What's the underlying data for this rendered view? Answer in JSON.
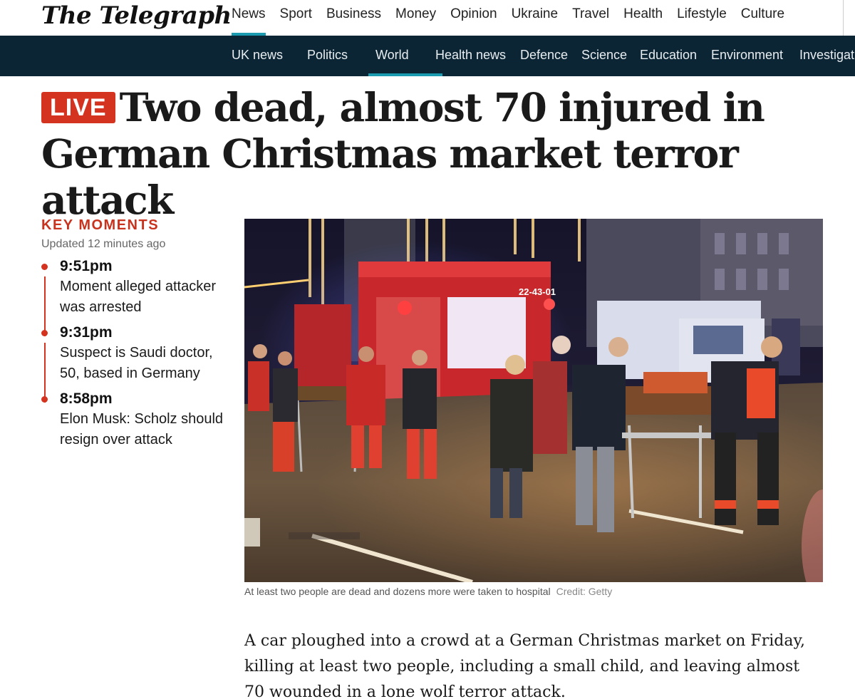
{
  "site": {
    "logo": "The Telegraph"
  },
  "top_nav": [
    "News",
    "Sport",
    "Business",
    "Money",
    "Opinion",
    "Ukraine",
    "Travel",
    "Health",
    "Lifestyle",
    "Culture"
  ],
  "sub_nav": [
    "UK news",
    "Politics",
    "World",
    "Health news",
    "Defence",
    "Science",
    "Education",
    "Environment",
    "Investigat"
  ],
  "article": {
    "live_badge": "LIVE",
    "headline": "Two dead, almost 70 injured in German Christmas market terror attack",
    "key_moments": {
      "title": "KEY MOMENTS",
      "updated": "Updated 12 minutes ago",
      "items": [
        {
          "time": "9:51pm",
          "text": "Moment alleged attacker was arrested"
        },
        {
          "time": "9:31pm",
          "text": "Suspect is Saudi doctor, 50, based in Germany"
        },
        {
          "time": "8:58pm",
          "text": "Elon Musk: Scholz should resign over attack"
        }
      ]
    },
    "image": {
      "caption": "At least two people are dead and dozens more were taken to hospital",
      "credit": "Credit: Getty",
      "truck_number": "22-43-01"
    },
    "lede": "A car ploughed into a crowd at a German Christmas market on Friday, killing at least two people, including a small child, and leaving almost 70 wounded in a lone wolf terror attack."
  },
  "colors": {
    "accent": "#1a9bb0",
    "live_red": "#d3331f",
    "subnav_bg": "#0b2535"
  }
}
